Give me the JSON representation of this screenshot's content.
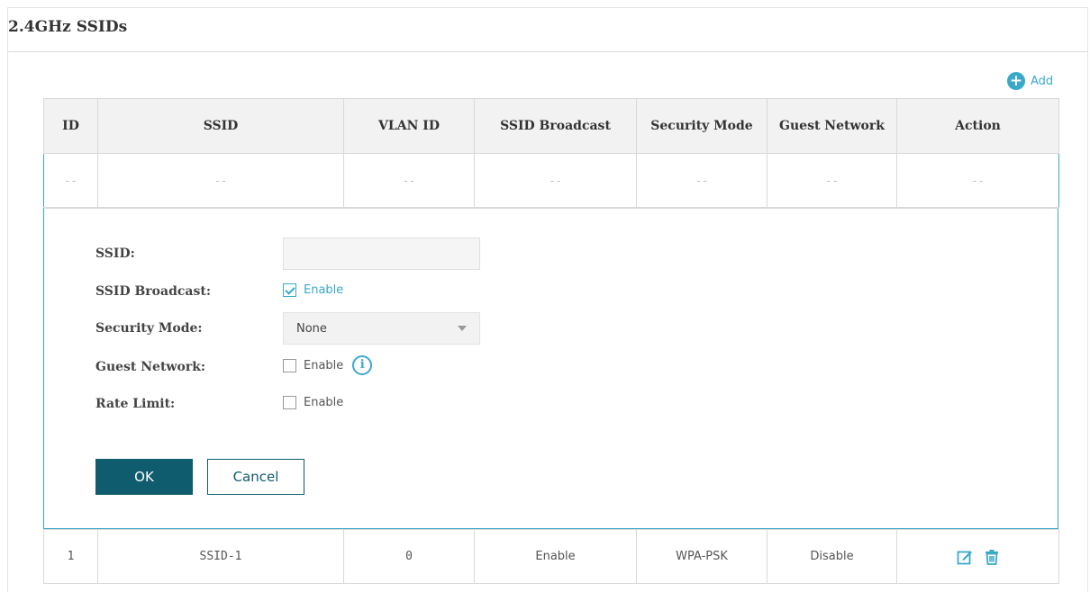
{
  "section": {
    "title": "2.4GHz SSIDs"
  },
  "toolbar": {
    "add_label": "Add",
    "add_icon": "plus-circle-icon"
  },
  "table": {
    "headers": [
      "ID",
      "SSID",
      "VLAN ID",
      "SSID Broadcast",
      "Security Mode",
      "Guest Network",
      "Action"
    ],
    "editing_row": [
      "--",
      "--",
      "--",
      "--",
      "--",
      "--",
      "--"
    ],
    "rows": [
      {
        "id": "1",
        "ssid": "SSID-1",
        "vlan": "0",
        "broadcast": "Enable",
        "security": "WPA-PSK",
        "guest": "Disable"
      }
    ]
  },
  "form": {
    "ssid_label": "SSID:",
    "ssid_value": "",
    "broadcast_label": "SSID Broadcast:",
    "broadcast_option": "Enable",
    "broadcast_checked": true,
    "security_label": "Security Mode:",
    "security_value": "None",
    "guest_label": "Guest Network:",
    "guest_option": "Enable",
    "guest_checked": false,
    "rate_label": "Rate Limit:",
    "rate_option": "Enable",
    "rate_checked": false,
    "ok_label": "OK",
    "cancel_label": "Cancel"
  },
  "colors": {
    "accent": "#3aa9c9",
    "primary_button": "#0f5c6e",
    "header_bg": "#f2f2f2"
  }
}
